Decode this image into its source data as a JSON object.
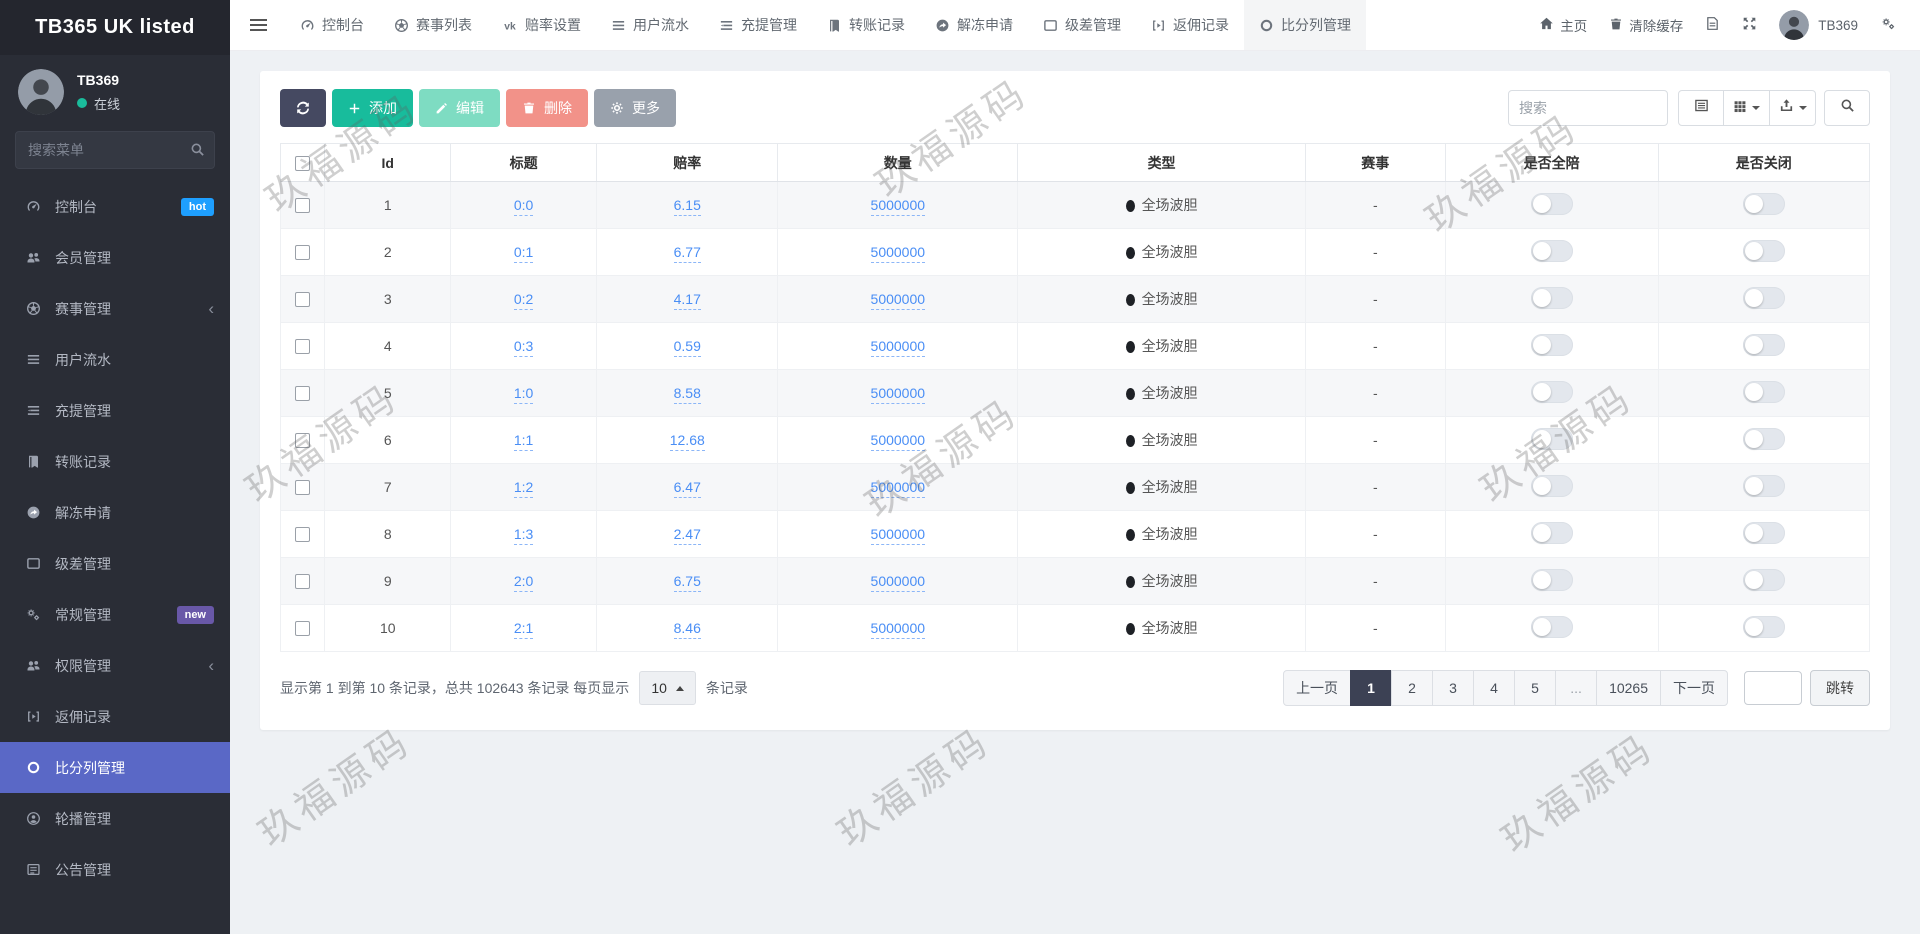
{
  "app": {
    "title": "TB365 UK listed"
  },
  "colors": {
    "content_bg": "#eef1f4",
    "sidebar_bg": "#2a2d36",
    "sidebar_logo_bg": "#24262e",
    "sidebar_active": "#5a68c6",
    "badge_hot": "#1e9fff",
    "badge_new": "#6958a8",
    "online_green": "#1abc9c",
    "dark_button": "#454961",
    "accent_green": "#18bc9c",
    "accent_green_light": "#7edcc2",
    "accent_red_light": "#f29289",
    "accent_gray": "#99a1ac",
    "link_blue": "#4a8ef5",
    "page_active": "#3c4154"
  },
  "sidebar": {
    "user": {
      "name": "TB369",
      "status": "在线"
    },
    "search_placeholder": "搜索菜单",
    "items": [
      {
        "icon": "gauge",
        "label": "控制台",
        "badge": "hot"
      },
      {
        "icon": "users",
        "label": "会员管理"
      },
      {
        "icon": "soccer",
        "label": "赛事管理",
        "chevron": true
      },
      {
        "icon": "list",
        "label": "用户流水"
      },
      {
        "icon": "list-alt",
        "label": "充提管理"
      },
      {
        "icon": "book",
        "label": "转账记录"
      },
      {
        "icon": "share",
        "label": "解冻申请"
      },
      {
        "icon": "window",
        "label": "级差管理"
      },
      {
        "icon": "gears",
        "label": "常规管理",
        "badge": "new"
      },
      {
        "icon": "users",
        "label": "权限管理",
        "chevron": true
      },
      {
        "icon": "bracket",
        "label": "返佣记录"
      },
      {
        "icon": "circle",
        "label": "比分列管理",
        "active": true
      },
      {
        "icon": "person-circle",
        "label": "轮播管理"
      },
      {
        "icon": "board",
        "label": "公告管理"
      }
    ]
  },
  "topnav": {
    "tabs": [
      {
        "icon": "gauge",
        "label": "控制台"
      },
      {
        "icon": "soccer",
        "label": "赛事列表"
      },
      {
        "icon": "vk",
        "label": "赔率设置"
      },
      {
        "icon": "list",
        "label": "用户流水"
      },
      {
        "icon": "list-alt",
        "label": "充提管理"
      },
      {
        "icon": "book",
        "label": "转账记录"
      },
      {
        "icon": "share",
        "label": "解冻申请"
      },
      {
        "icon": "window",
        "label": "级差管理"
      },
      {
        "icon": "bracket",
        "label": "返佣记录"
      },
      {
        "icon": "circle",
        "label": "比分列管理",
        "active": true
      }
    ],
    "right": {
      "home": "主页",
      "clear_cache": "清除缓存",
      "username": "TB369"
    }
  },
  "toolbar": {
    "add": "添加",
    "edit": "编辑",
    "delete": "删除",
    "more": "更多",
    "search_placeholder": "搜索"
  },
  "table": {
    "headers": [
      "Id",
      "标题",
      "赔率",
      "数量",
      "类型",
      "赛事",
      "是否全陪",
      "是否关闭"
    ],
    "rows": [
      {
        "id": "1",
        "title": "0:0",
        "odds": "6.15",
        "qty": "5000000",
        "type": "全场波胆",
        "match": "-"
      },
      {
        "id": "2",
        "title": "0:1",
        "odds": "6.77",
        "qty": "5000000",
        "type": "全场波胆",
        "match": "-"
      },
      {
        "id": "3",
        "title": "0:2",
        "odds": "4.17",
        "qty": "5000000",
        "type": "全场波胆",
        "match": "-"
      },
      {
        "id": "4",
        "title": "0:3",
        "odds": "0.59",
        "qty": "5000000",
        "type": "全场波胆",
        "match": "-"
      },
      {
        "id": "5",
        "title": "1:0",
        "odds": "8.58",
        "qty": "5000000",
        "type": "全场波胆",
        "match": "-"
      },
      {
        "id": "6",
        "title": "1:1",
        "odds": "12.68",
        "qty": "5000000",
        "type": "全场波胆",
        "match": "-"
      },
      {
        "id": "7",
        "title": "1:2",
        "odds": "6.47",
        "qty": "5000000",
        "type": "全场波胆",
        "match": "-"
      },
      {
        "id": "8",
        "title": "1:3",
        "odds": "2.47",
        "qty": "5000000",
        "type": "全场波胆",
        "match": "-"
      },
      {
        "id": "9",
        "title": "2:0",
        "odds": "6.75",
        "qty": "5000000",
        "type": "全场波胆",
        "match": "-"
      },
      {
        "id": "10",
        "title": "2:1",
        "odds": "8.46",
        "qty": "5000000",
        "type": "全场波胆",
        "match": "-"
      }
    ]
  },
  "pagination": {
    "summary_prefix": "显示第 1 到第 10 条记录，总共 102643 条记录 每页显示",
    "page_size": "10",
    "summary_suffix": "条记录",
    "prev": "上一页",
    "pages": [
      "1",
      "2",
      "3",
      "4",
      "5",
      "...",
      "10265"
    ],
    "active_page": "1",
    "next": "下一页",
    "jump": "跳转"
  },
  "watermark": {
    "text": "玖福源码"
  }
}
